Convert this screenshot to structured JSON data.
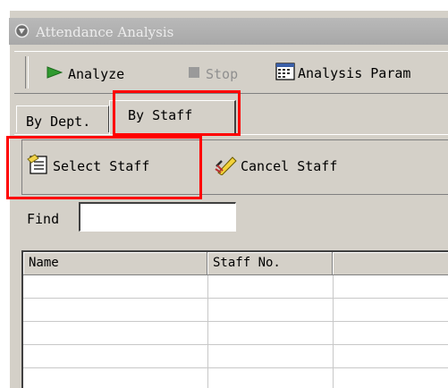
{
  "window": {
    "title": "Attendance Analysis",
    "title_icon": "app-icon"
  },
  "toolbar": {
    "analyze_label": "Analyze",
    "stop_label": "Stop",
    "params_label": "Analysis Param",
    "analyze_icon": "play-arrow-icon",
    "stop_icon": "stop-square-icon",
    "params_icon": "calendar-grid-icon"
  },
  "tabs": [
    {
      "label": "By Dept.",
      "selected": false
    },
    {
      "label": "By Staff",
      "selected": true
    }
  ],
  "staff_panel": {
    "select_label": "Select Staff",
    "cancel_label": "Cancel Staff",
    "select_icon": "select-list-icon",
    "cancel_icon": "cancel-pen-icon"
  },
  "find": {
    "label": "Find",
    "value": ""
  },
  "grid": {
    "columns": [
      "Name",
      "Staff No."
    ],
    "rows": []
  },
  "colors": {
    "highlight": "#ff0000",
    "face": "#d4d0c8",
    "analyze_green": "#2f9a2f"
  }
}
